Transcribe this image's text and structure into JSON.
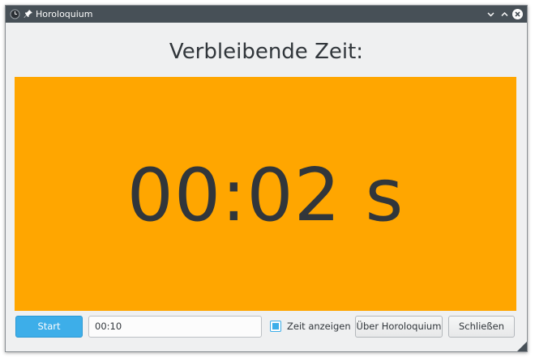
{
  "window": {
    "title": "Horoloquium"
  },
  "main": {
    "heading": "Verbleibende Zeit:",
    "timer_display": "00:02 s",
    "timer_background": "#ffa600"
  },
  "controls": {
    "start_label": "Start",
    "duration_value": "00:10",
    "show_time_checked": true,
    "show_time_label": "Zeit anzeigen",
    "about_label": "Über Horoloquium",
    "close_label": "Schließen"
  },
  "colors": {
    "accent": "#3daee9",
    "titlebar": "#475057",
    "text": "#31363b"
  },
  "icons": {
    "app": "clock-icon",
    "pin": "pin-icon",
    "minimize": "minimize-icon",
    "maximize": "maximize-icon",
    "close": "close-icon",
    "resize": "resize-grip-icon"
  }
}
